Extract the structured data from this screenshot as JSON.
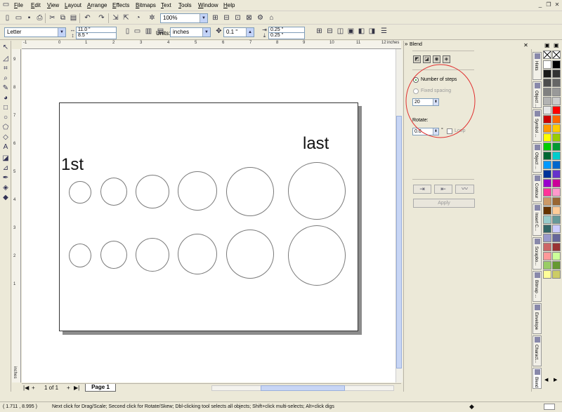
{
  "menu": [
    "File",
    "Edit",
    "View",
    "Layout",
    "Arrange",
    "Effects",
    "Bitmaps",
    "Text",
    "Tools",
    "Window",
    "Help"
  ],
  "toolbar": {
    "zoom": "100%"
  },
  "property_bar": {
    "page_size": "Letter",
    "width": "11.0 \"",
    "height": "8.5 \"",
    "units_label": "Units:",
    "units": "inches",
    "nudge": "0.1 \"",
    "dup_x": "0.25 \"",
    "dup_y": "0.25 \""
  },
  "ruler": {
    "h_ticks": [
      "-1",
      "0",
      "1",
      "2",
      "3",
      "4",
      "5",
      "6",
      "7",
      "8",
      "9",
      "10",
      "11",
      "12"
    ],
    "h_unit": "inches",
    "v_ticks": [
      "9",
      "8",
      "7",
      "6",
      "5",
      "4",
      "3",
      "2",
      "1"
    ],
    "v_unit": "inches"
  },
  "canvas": {
    "label_first": "1st",
    "label_last": "last"
  },
  "navigator": {
    "page_count": "1 of 1",
    "page_tab": "Page 1"
  },
  "status": {
    "coords": "( 1.711 , 8.995 )",
    "hint": "Next click for Drag/Scale; Second click for Rotate/Skew; Dbl-clicking tool selects all objects; Shift+click multi-selects; Alt+click digs"
  },
  "docker": {
    "title": "Blend",
    "number_of_steps_label": "Number of steps",
    "fixed_spacing_label": "Fixed spacing",
    "steps_value": "20",
    "rotate_label": "Rotate:",
    "rotate_value": "0.0",
    "rotate_unit": "°",
    "loop_label": "Loop",
    "apply_label": "Apply"
  },
  "docker_tabs": [
    "Hints",
    "Object ...",
    "Symbol ...",
    "Object ...",
    "Contour",
    "Insert C...",
    "Scrapbo...",
    "Bitmap ...",
    "Envelope",
    "Charact...",
    "Blend"
  ],
  "palette_colors": [
    "#ffffff",
    "#000000",
    "#1a1a1a",
    "#333333",
    "#4d4d4d",
    "#666666",
    "#808080",
    "#999999",
    "#b3b3b3",
    "#cccccc",
    "#e6e6e6",
    "#ff0000",
    "#cc0000",
    "#ff6600",
    "#ff9900",
    "#ffcc00",
    "#ffff00",
    "#99cc00",
    "#00cc00",
    "#009933",
    "#006633",
    "#00cccc",
    "#0099ff",
    "#0066cc",
    "#003399",
    "#6633cc",
    "#9900cc",
    "#cc0099",
    "#ff3399",
    "#ff99cc",
    "#cc9966",
    "#996633",
    "#663300",
    "#ffcc99",
    "#99cccc",
    "#669999",
    "#336666",
    "#ccccff",
    "#9999cc",
    "#666699",
    "#cc6666",
    "#993333",
    "#ff9999",
    "#ccff99",
    "#99cc66",
    "#669933",
    "#ffff99",
    "#cccc66"
  ]
}
